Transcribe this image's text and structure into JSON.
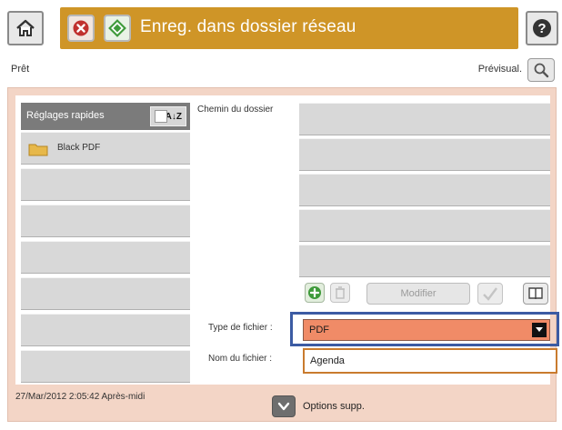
{
  "header": {
    "title": "Enreg. dans dossier réseau",
    "icons": {
      "home": "home-icon",
      "stop": "stop-icon",
      "start": "start-icon",
      "help": "help-icon"
    },
    "accent_color": "#cf9527"
  },
  "status": {
    "text": "Prêt",
    "preview_label": "Prévisual."
  },
  "quick_sets": {
    "title": "Réglages rapides",
    "sort_label": "A↓Z",
    "items": [
      {
        "label": "Black PDF",
        "icon": "folder-icon"
      },
      {
        "label": ""
      },
      {
        "label": ""
      },
      {
        "label": ""
      },
      {
        "label": ""
      },
      {
        "label": ""
      },
      {
        "label": ""
      },
      {
        "label": ""
      }
    ]
  },
  "folder_path": {
    "label": "Chemin du dossier",
    "modify_label": "Modifier"
  },
  "file_type": {
    "label": "Type de fichier :",
    "value": "PDF"
  },
  "file_name": {
    "label": "Nom du fichier :",
    "value": "Agenda"
  },
  "footer": {
    "datetime": "27/Mar/2012 2:05:42 Après-midi",
    "more_options_label": "Options supp."
  }
}
